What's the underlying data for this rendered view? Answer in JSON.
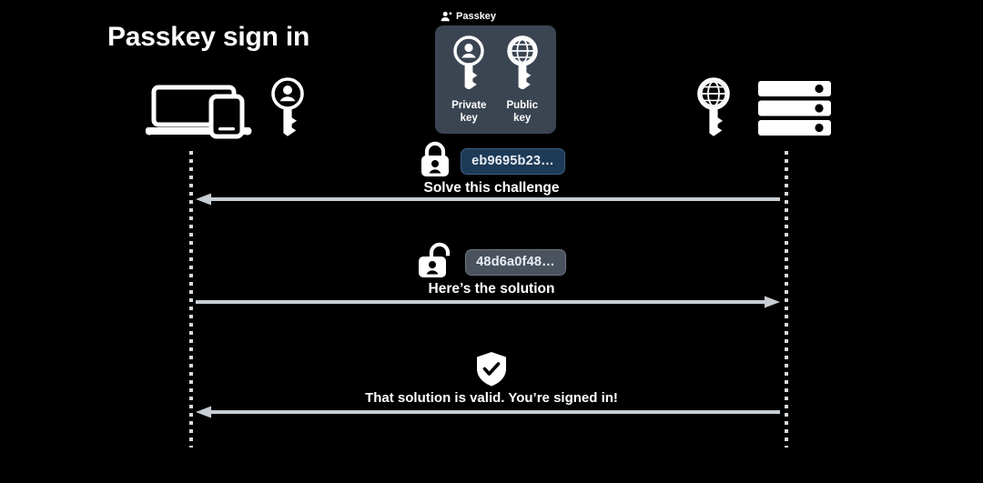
{
  "page": {
    "title": "Passkey sign in",
    "background_color": "#000000"
  },
  "passkey": {
    "caption": "Passkey",
    "caption_icon": "person-badge-icon",
    "card_color": "#3b4552",
    "keys": [
      {
        "icon": "private-key-icon",
        "label": "Private\nkey"
      },
      {
        "icon": "public-key-icon",
        "label": "Public\nkey"
      }
    ]
  },
  "actors": {
    "client": {
      "icon": "laptop-phone-icon",
      "name": "client-devices"
    },
    "client_key": {
      "icon": "private-key-icon",
      "name": "client-private-key"
    },
    "server_key": {
      "icon": "public-key-icon",
      "name": "server-public-key"
    },
    "server": {
      "icon": "server-stack-icon",
      "name": "server"
    }
  },
  "messages": [
    {
      "icon": "locked-padlock-person-icon",
      "badge": "eb9695b23…",
      "badge_style": "challenge",
      "badge_color": "#1d3a57",
      "label": "Solve this challenge",
      "direction": "left"
    },
    {
      "icon": "unlocked-padlock-person-icon",
      "badge": "48d6a0f48…",
      "badge_style": "solution",
      "badge_color": "#4a535d",
      "label": "Here’s the solution",
      "direction": "right"
    },
    {
      "icon": "shield-check-icon",
      "badge": "",
      "badge_style": "none",
      "badge_color": "",
      "label": "That solution is valid. You’re signed in!",
      "direction": "left"
    }
  ],
  "lifelines": {
    "color": "#d8dce0",
    "client_label": "client-lifeline",
    "server_label": "server-lifeline"
  },
  "arrow_color": "#c7ced4"
}
